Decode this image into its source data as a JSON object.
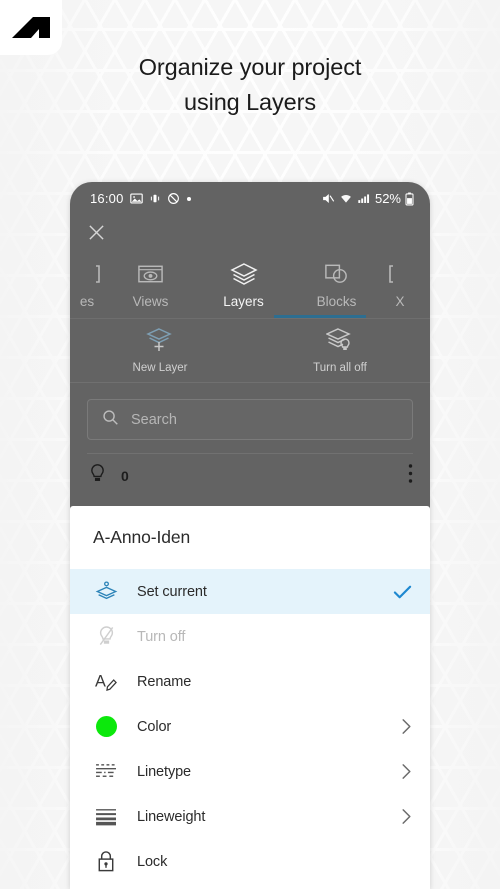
{
  "brand": {
    "logo_icon": "autocad-logo-icon"
  },
  "headline": {
    "line1": "Organize your project",
    "line2": "using Layers"
  },
  "phone": {
    "statusbar": {
      "time": "16:00",
      "left_icons": [
        "photo-icon",
        "vibrate-icon",
        "do-not-disturb-icon",
        "dot-icon"
      ],
      "right_icons": [
        "mute-icon",
        "wifi-icon",
        "signal-icon"
      ],
      "battery_pct": "52%",
      "battery_icon": "battery-icon"
    },
    "close_button": {
      "icon": "close-icon",
      "label": "Close"
    },
    "tabs": [
      {
        "label": "es",
        "icon": "files-icon",
        "active": false,
        "partial": true
      },
      {
        "label": "Views",
        "icon": "eye-view-icon",
        "active": false,
        "partial": false
      },
      {
        "label": "Layers",
        "icon": "layers-icon",
        "active": true,
        "partial": false
      },
      {
        "label": "Blocks",
        "icon": "blocks-icon",
        "active": false,
        "partial": false
      },
      {
        "label": "X",
        "icon": "xrefs-icon",
        "active": false,
        "partial": true
      }
    ],
    "actions": [
      {
        "label": "New Layer",
        "icon": "layers-add-icon"
      },
      {
        "label": "Turn all off",
        "icon": "layers-bulb-off-icon"
      }
    ],
    "search": {
      "placeholder": "Search",
      "icon": "search-icon",
      "value": ""
    },
    "layer_row": {
      "visibility_icon": "lightbulb-icon",
      "name": "0",
      "overflow_icon": "more-vertical-icon"
    }
  },
  "sheet": {
    "title": "A-Anno-Iden",
    "items": [
      {
        "label": "Set current",
        "icon": "layers-current-icon",
        "state": "selected",
        "trailing": "check-icon"
      },
      {
        "label": "Turn off",
        "icon": "lightbulb-off-icon",
        "state": "disabled",
        "trailing": ""
      },
      {
        "label": "Rename",
        "icon": "rename-pencil-icon",
        "state": "normal",
        "trailing": ""
      },
      {
        "label": "Color",
        "icon": "color-swatch-icon",
        "state": "normal",
        "trailing": "chevron-right-icon"
      },
      {
        "label": "Linetype",
        "icon": "linetype-icon",
        "state": "normal",
        "trailing": "chevron-right-icon"
      },
      {
        "label": "Lineweight",
        "icon": "lineweight-icon",
        "state": "normal",
        "trailing": "chevron-right-icon"
      },
      {
        "label": "Lock",
        "icon": "lock-icon",
        "state": "normal",
        "trailing": ""
      }
    ]
  },
  "colors": {
    "accent_blue": "#2d6e91",
    "check_blue": "#1e88d0",
    "highlight_bg": "#e4f3fb",
    "layer_green": "#0ce80c",
    "phone_dim": "#636363",
    "page_bg": "#f4f4f4"
  }
}
